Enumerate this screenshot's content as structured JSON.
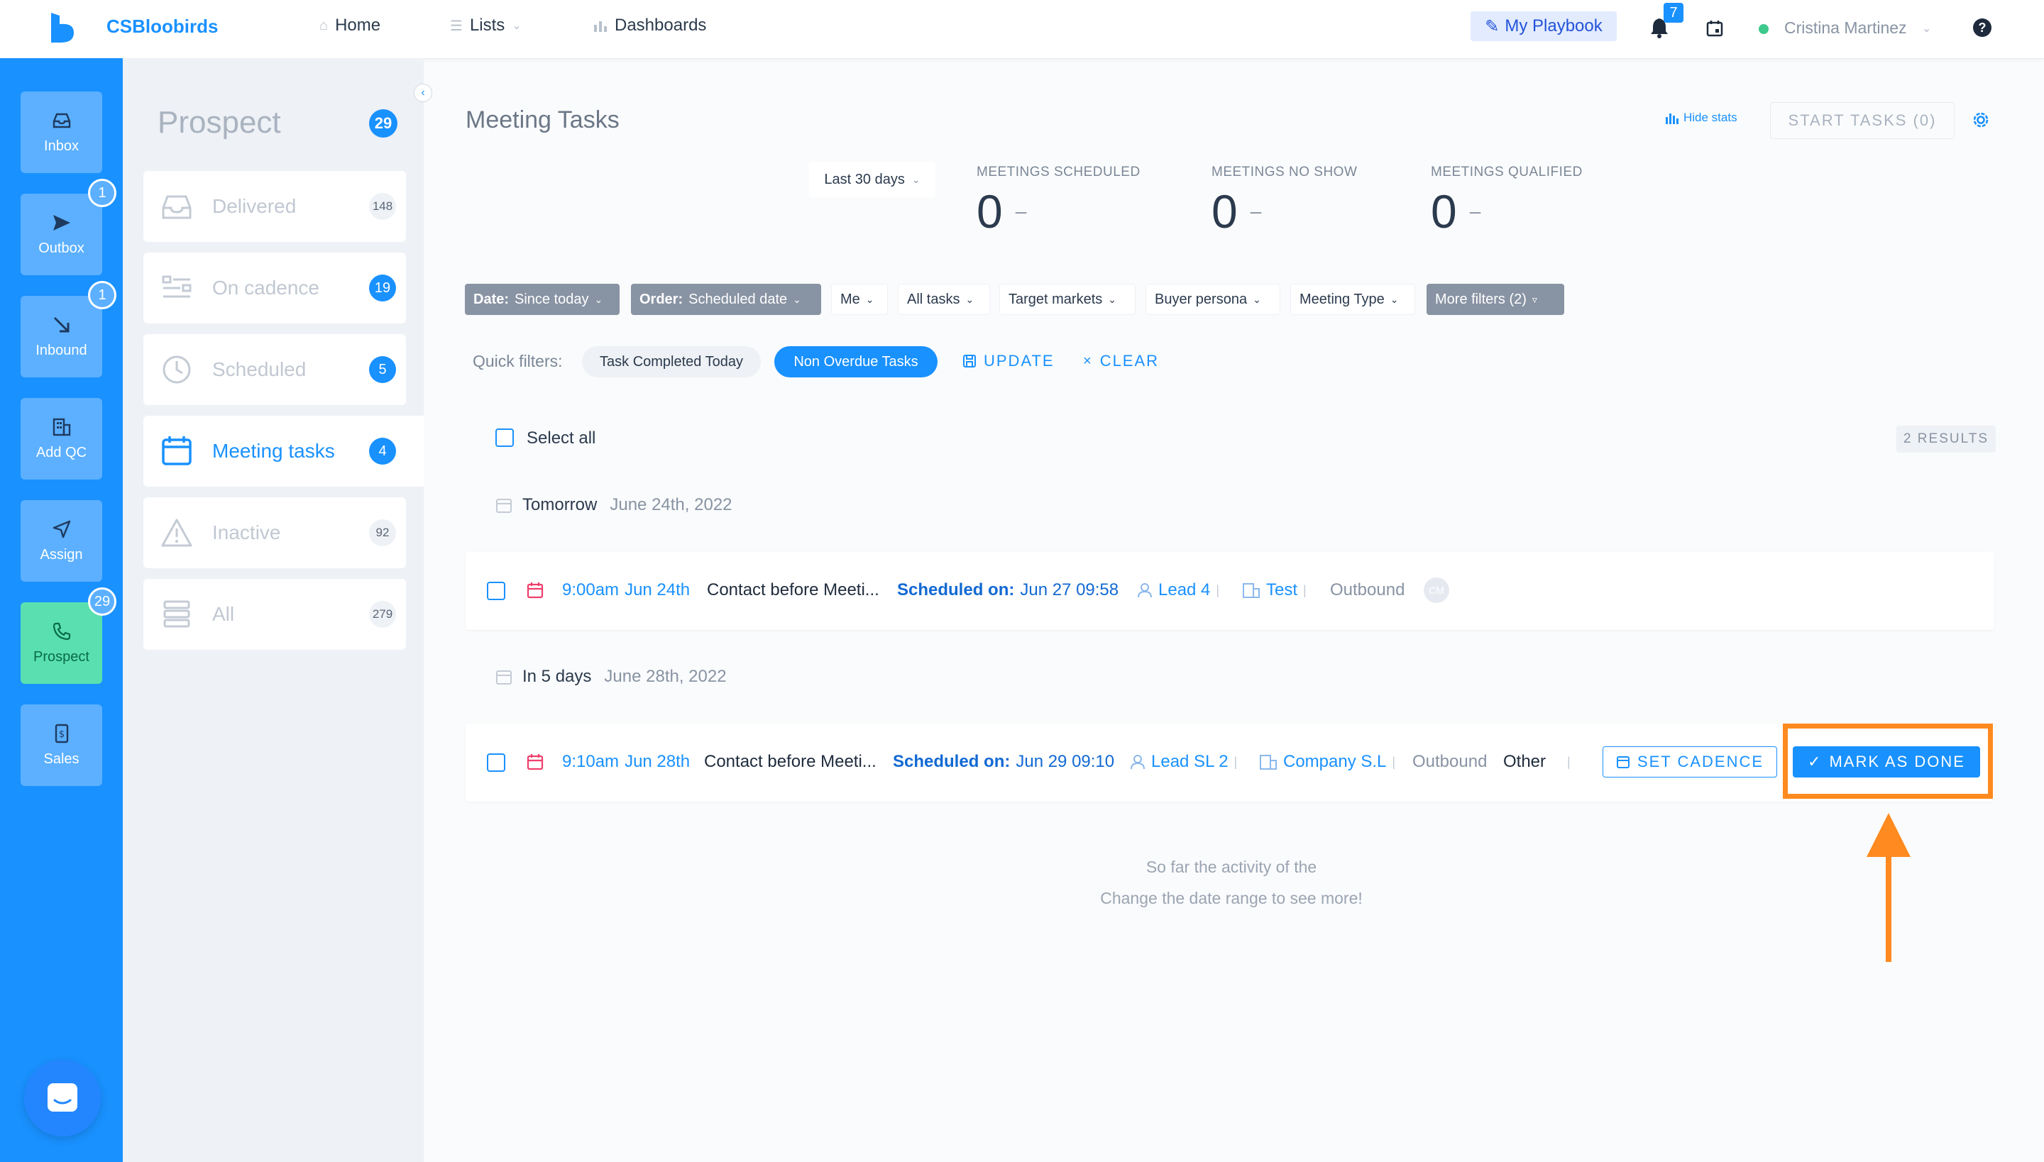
{
  "topbar": {
    "brand": "CSBloobirds",
    "nav": [
      {
        "label": "Home",
        "icon": "home-icon"
      },
      {
        "label": "Lists",
        "icon": "list-icon"
      },
      {
        "label": "Dashboards",
        "icon": "bar-chart-icon"
      }
    ],
    "playbook_label": "My Playbook",
    "notifications_count": "7",
    "user_name": "Cristina Martinez"
  },
  "rail": [
    {
      "label": "Inbox",
      "icon": "inbox-icon"
    },
    {
      "label": "Outbox",
      "icon": "send-icon",
      "badge": "1"
    },
    {
      "label": "Inbound",
      "icon": "arrow-down-right-icon",
      "badge": "1"
    },
    {
      "label": "Add QC",
      "icon": "building-icon"
    },
    {
      "label": "Assign",
      "icon": "navigation-icon"
    },
    {
      "label": "Prospect",
      "icon": "phone-icon",
      "badge": "29"
    },
    {
      "label": "Sales",
      "icon": "dollar-icon"
    }
  ],
  "sidebar": {
    "title": "Prospect",
    "title_count": "29",
    "items": [
      {
        "label": "Delivered",
        "count": "148"
      },
      {
        "label": "On cadence",
        "count": "19"
      },
      {
        "label": "Scheduled",
        "count": "5"
      },
      {
        "label": "Meeting tasks",
        "count": "4"
      },
      {
        "label": "Inactive",
        "count": "92"
      },
      {
        "label": "All",
        "count": "279"
      }
    ]
  },
  "main": {
    "title": "Meeting Tasks",
    "hide_stats": "Hide stats",
    "start_tasks": "START TASKS (0)",
    "range": "Last 30 days",
    "stats": [
      {
        "label": "MEETINGS SCHEDULED",
        "value": "0",
        "trend": "–"
      },
      {
        "label": "MEETINGS NO SHOW",
        "value": "0",
        "trend": "–"
      },
      {
        "label": "MEETINGS QUALIFIED",
        "value": "0",
        "trend": "–"
      }
    ],
    "filters": {
      "date_key": "Date:",
      "date_val": "Since today",
      "order_key": "Order:",
      "order_val": "Scheduled date",
      "me": "Me",
      "all_tasks": "All tasks",
      "target_markets": "Target markets",
      "buyer_persona": "Buyer persona",
      "meeting_type": "Meeting Type",
      "more_filters": "More filters (2)"
    },
    "quick_filters": {
      "label": "Quick filters:",
      "task_completed": "Task Completed Today",
      "non_overdue": "Non Overdue Tasks",
      "update": "UPDATE",
      "clear": "CLEAR"
    },
    "select_all": "Select all",
    "results": "2 RESULTS",
    "groups": [
      {
        "day": "Tomorrow",
        "date": "June 24th, 2022",
        "task": {
          "time": "9:00am",
          "day": "Jun 24th",
          "title": "Contact before Meeti...",
          "scheduled_label": "Scheduled on:",
          "scheduled_val": "Jun 27 09:58",
          "lead": "Lead 4",
          "company": "Test",
          "source": "Outbound",
          "avatar": "CM"
        }
      },
      {
        "day": "In 5 days",
        "date": "June 28th, 2022",
        "task": {
          "time": "9:10am",
          "day": "Jun 28th",
          "title": "Contact before Meeti...",
          "scheduled_label": "Scheduled on:",
          "scheduled_val": "Jun 29 09:10",
          "lead": "Lead SL 2",
          "company": "Company S.L",
          "source": "Outbound",
          "type": "Other",
          "set_cadence": "SET CADENCE",
          "mark_done": "MARK AS DONE"
        }
      }
    ],
    "empty_line1": "So far the activity of the",
    "empty_line2": "Change the date range to see more!"
  },
  "colors": {
    "accent": "#1991ff",
    "highlight": "#ff8a1f",
    "prospect_active": "#5ae0b0"
  }
}
